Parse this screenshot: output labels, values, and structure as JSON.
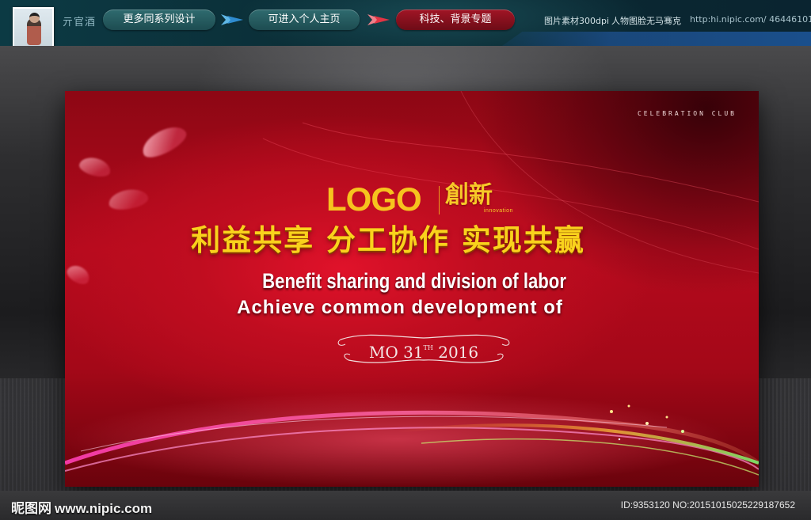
{
  "header": {
    "brand_name": "亓官酒",
    "series_button": "更多同系列设计",
    "home_button": "可进入个人主页",
    "topic_button": "科技、背景专题",
    "dpi_info": "图片素材300dpi",
    "free_info": "人物图脸无马骞克",
    "user_url": "http:hi.nipic.com/ 464461016"
  },
  "banner": {
    "club": "CELEBRATION CLUB",
    "logo": "LOGO",
    "logo_cn": "創新",
    "logo_sub": "innovation",
    "headline": "利益共享  分工协作  实现共赢",
    "subtitle_1": "Benefit sharing and division of labor",
    "subtitle_2": "Achieve common development of",
    "date_pre": "MO 31",
    "date_sup": "TH",
    "date_year": " 2016"
  },
  "footer": {
    "watermark_cn": "昵图网",
    "watermark_url": "www.nipic.com",
    "id_text": "ID:9353120 NO:20151015025229187652"
  },
  "colors": {
    "header_bg": "#0b2f38",
    "pill_teal": "#1d4c51",
    "pill_red": "#a11525",
    "banner_red": "#c00d20",
    "headline_yellow": "#f9d21c",
    "logo_gold": "#f6c31e"
  },
  "icons": [
    "blue-arrow-icon",
    "red-arrow-icon",
    "avatar-photo"
  ]
}
